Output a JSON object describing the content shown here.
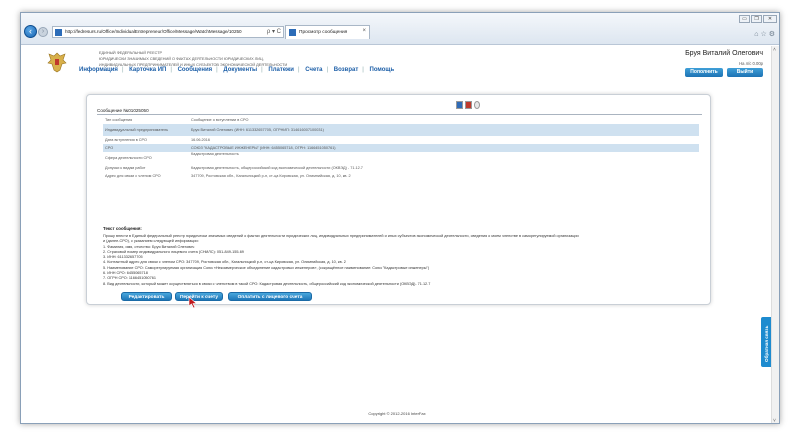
{
  "browser": {
    "url": "http://fedresurs.ru/Office/IndividualEntrepreneur/Office/Message/WatchMessage/10250",
    "tab_title": "Просмотр сообщения",
    "address_controls": "ρ ▾ C",
    "tab_close": "×",
    "window_buttons": [
      "▭",
      "❐",
      "✕"
    ],
    "tool_icons": "⌂☆⚙"
  },
  "header": {
    "org_lines": [
      "Единый федеральный реестр",
      "юридически значимых сведений о фактах деятельности юридических лиц,",
      "индивидуальных предпринимателей и иных субъектов экономической деятельности"
    ],
    "user_name": "Бруя Виталий Олегович",
    "balance": "На л/с 0.00р",
    "topup_label": "Пополнить",
    "logout_label": "Выйти",
    "menu": [
      "Информация",
      "Карточка ИП",
      "Сообщения",
      "Документы",
      "Платежи",
      "Счета",
      "Возврат",
      "Помощь"
    ]
  },
  "message": {
    "heading": "Сообщение №01025050",
    "details": [
      {
        "key": "Тип сообщения",
        "value": "Сообщение о вступлении в СРО",
        "hl": false
      },
      {
        "key": "Индивидуальный предприниматель",
        "value": "Бруя Виталий Олегович (ИНН: 611332657705, ОГРНИП: 314616007100031)",
        "hl": true
      },
      {
        "key": "Дата вступления в СРО",
        "value": "16.06.2016",
        "hl": false
      },
      {
        "key": "СРО",
        "value": "СОЮЗ \"КАДАСТРОВЫЕ ИНЖЕНЕРЫ\" (ИНН: 6455065718, ОГРН: 1166451050761)",
        "hl": true
      },
      {
        "key": "Сфера деятельности СРО",
        "value": "Кадастровая деятельность",
        "hl": false
      },
      {
        "key": "Допуски к видам работ",
        "value": "Кадастровая деятельность, общероссийский код экономической деятельности (ОКВЭД) - 71.12.7",
        "hl": false
      },
      {
        "key": "Адрес для связи с членом СРО",
        "value": "347709, Ростовская обл., Кагальницкий р-н, ст-ца Кировская, ул. Олимпийская, д. 10, кв. 2",
        "hl": false
      }
    ],
    "text_title": "Текст сообщения:",
    "text_lines": [
      "Прошу внести в Единый федеральный реестр юридически значимых сведений о фактах деятельности юридических лиц, индивидуальных предпринимателей и иных субъектов экономической деятельности, сведения о моем членстве в саморегулируемой организации",
      "и (далее-СРО), с указанием следующей информации:",
      "1. Фамилия, имя, отчество: Бруя Виталий Олегович",
      "2. Страховой номер индивидуального лицевого счета (СНИЛС): 051-849-155-69",
      "3. ИНН: 611332657705",
      "4. Контактный адрес для связи с членом СРО: 347709, Ростовская обл., Кагальницкий р-н, ст-ца Кировская, ул. Олимпийская, д. 10, кв. 2",
      "5. Наименование СРО: Саморегулируемая организация Союз «Некоммерческое объединение кадастровых инженеров», (сокращённое наименование: Союз \"Кадастровые инженеры\")",
      "6. ИНН СРО: 6455065718",
      "7. ОГРН СРО: 1166451050761",
      "8. Вид деятельности, который может осуществляться в связи с членством в такой СРО: Кадастровая деятельность, общероссийский код экономической деятельности (ОКВЭД)- 71.12.7"
    ],
    "edit_label": "Редактировать",
    "to_invoice_label": "Перейти к счету",
    "pay_label": "Оплатить с лицевого счета"
  },
  "feedback_label": "Обратная связь",
  "copyright": "Copyright © 2012-2016 InterFax",
  "colors": {
    "accent": "#1d73b4",
    "highlight_row": "#cfe1f0",
    "menu_link": "#1d5fa8"
  }
}
